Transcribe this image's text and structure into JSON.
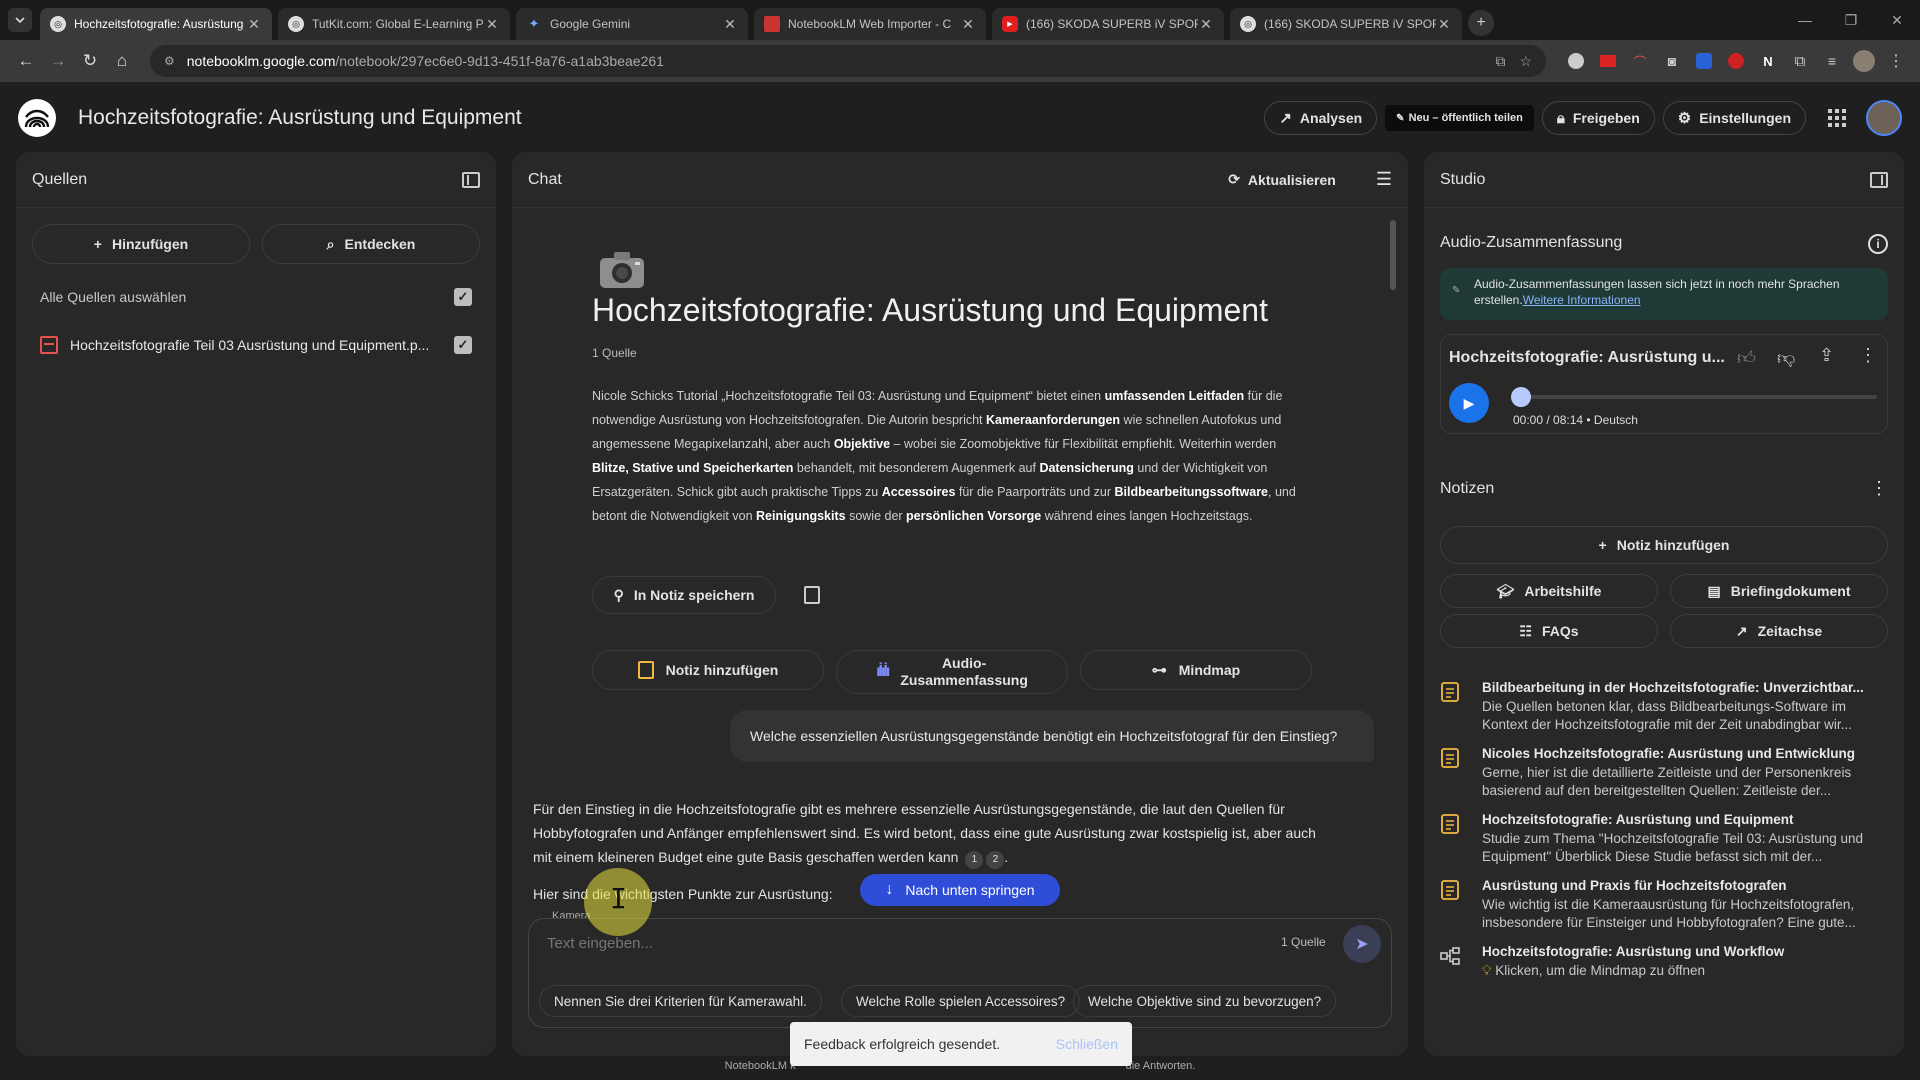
{
  "browser": {
    "tabs": [
      {
        "title": "Hochzeitsfotografie: Ausrüstung",
        "active": true
      },
      {
        "title": "TutKit.com: Global E-Learning P",
        "active": false
      },
      {
        "title": "Google Gemini",
        "active": false
      },
      {
        "title": "NotebookLM Web Importer - C",
        "active": false
      },
      {
        "title": "(166) SKODA SUPERB iV SPORT",
        "active": false
      },
      {
        "title": "(166) SKODA SUPERB iV SPORT",
        "active": false
      }
    ],
    "url_host": "notebooklm.google.com",
    "url_path": "/notebook/297ec6e0-9d13-451f-8a76-a1ab3beae261"
  },
  "header": {
    "title": "Hochzeitsfotografie: Ausrüstung und Equipment",
    "analytics": "Analysen",
    "new_badge": "Neu – öffentlich teilen",
    "share": "Freigeben",
    "settings": "Einstellungen"
  },
  "sources": {
    "title": "Quellen",
    "add": "Hinzufügen",
    "discover": "Entdecken",
    "select_all": "Alle Quellen auswählen",
    "items": [
      {
        "label": "Hochzeitsfotografie Teil 03 Ausrüstung und Equipment.p..."
      }
    ]
  },
  "chat": {
    "title": "Chat",
    "refresh": "Aktualisieren",
    "notebook_title": "Hochzeitsfotografie: Ausrüstung und Equipment",
    "source_count": "1 Quelle",
    "summary": [
      {
        "t": "Nicole Schicks Tutorial „Hochzeitsfotografie Teil 03: Ausrüstung und Equipment“ bietet einen ",
        "b": false
      },
      {
        "t": "umfassenden Leitfaden",
        "b": true
      },
      {
        "t": " für die notwendige Ausrüstung von Hochzeitsfotografen. Die Autorin bespricht ",
        "b": false
      },
      {
        "t": "Kameraanforderungen",
        "b": true
      },
      {
        "t": " wie schnellen Autofokus und angemessene Megapixelanzahl, aber auch ",
        "b": false
      },
      {
        "t": "Objektive",
        "b": true
      },
      {
        "t": " – wobei sie Zoomobjektive für Flexibilität empfiehlt. Weiterhin werden ",
        "b": false
      },
      {
        "t": "Blitze, Stative und Speicherkarten",
        "b": true
      },
      {
        "t": " behandelt, mit besonderem Augenmerk auf ",
        "b": false
      },
      {
        "t": "Datensicherung",
        "b": true
      },
      {
        "t": " und der Wichtigkeit von Ersatzgeräten. Schick gibt auch praktische Tipps zu ",
        "b": false
      },
      {
        "t": "Accessoires",
        "b": true
      },
      {
        "t": " für die Paarporträts und zur ",
        "b": false
      },
      {
        "t": "Bildbearbeitungssoftware",
        "b": true
      },
      {
        "t": ", und betont die Notwendigkeit von ",
        "b": false
      },
      {
        "t": "Reinigungskits",
        "b": true
      },
      {
        "t": " sowie der ",
        "b": false
      },
      {
        "t": "persönlichen Vorsorge",
        "b": true
      },
      {
        "t": " während eines langen Hochzeitstags.",
        "b": false
      }
    ],
    "save_note": "In Notiz speichern",
    "tiles": {
      "add_note": "Notiz hinzufügen",
      "audio_line1": "Audio-",
      "audio_line2": "Zusammenfassung",
      "mindmap": "Mindmap"
    },
    "user_question": "Welche essenziellen Ausrüstungsgegenstände benötigt ein Hochzeitsfotograf für den Einstieg?",
    "answer": "Für den Einstieg in die Hochzeitsfotografie gibt es mehrere essenzielle Ausrüstungsgegenstände, die laut den Quellen für Hobbyfotografen und Anfänger empfehlenswert sind. Es wird betont, dass eine gute Ausrüstung zwar kostspielig ist, aber auch mit einem kleineren Budget eine gute Basis geschaffen werden kann",
    "citations": [
      "1",
      "2"
    ],
    "answer_points": "Hier sind die wichtigsten Punkte zur Ausrüstung:",
    "answer_cut": "Kamera",
    "jump_down": "Nach unten springen",
    "input_placeholder": "Text eingeben...",
    "input_source_count": "1 Quelle",
    "suggestions": [
      "Nennen Sie drei Kriterien für Kamerawahl.",
      "Welche Rolle spielen Accessoires?",
      "Welche Objektive sind zu bevorzugen?"
    ]
  },
  "toast": {
    "message": "Feedback erfolgreich gesendet.",
    "close": "Schließen"
  },
  "footer": {
    "left": "NotebookLM k",
    "right": "die Antworten."
  },
  "studio": {
    "title": "Studio",
    "audio_heading": "Audio-Zusammenfassung",
    "banner_text": "Audio-Zusammenfassungen lassen sich jetzt in noch mehr Sprachen erstellen.",
    "banner_link": "Weitere Informationen",
    "player_title": "Hochzeitsfotografie: Ausrüstung u...",
    "player_time": "00:00 / 08:14 • Deutsch",
    "player_progress": 0.0,
    "notes_heading": "Notizen",
    "add_note": "Notiz hinzufügen",
    "buttons": {
      "study_guide": "Arbeitshilfe",
      "briefing": "Briefingdokument",
      "faq": "FAQs",
      "timeline": "Zeitachse"
    },
    "notes": [
      {
        "title": "Bildbearbeitung in der Hochzeitsfotografie: Unverzichtbar...",
        "body": "Die Quellen betonen klar, dass Bildbearbeitungs-Software im Kontext der Hochzeitsfotografie mit der Zeit unabdingbar wir...",
        "icon": "note-icon"
      },
      {
        "title": "Nicoles Hochzeitsfotografie: Ausrüstung und Entwicklung",
        "body": "Gerne, hier ist die detaillierte Zeitleiste und der Personenkreis basierend auf den bereitgestellten Quellen: Zeitleiste der...",
        "icon": "note-icon"
      },
      {
        "title": "Hochzeitsfotografie: Ausrüstung und Equipment",
        "body": "Studie zum Thema \"Hochzeitsfotografie Teil 03: Ausrüstung und Equipment\" Überblick Diese Studie befasst sich mit der...",
        "icon": "note-icon"
      },
      {
        "title": "Ausrüstung und Praxis für Hochzeitsfotografen",
        "body": "Wie wichtig ist die Kameraausrüstung für Hochzeitsfotografen, insbesondere für Einsteiger und Hobbyfotografen? Eine gute...",
        "icon": "note-icon"
      },
      {
        "title": "Hochzeitsfotografie: Ausrüstung und Workflow",
        "body": "Klicken, um die Mindmap zu öffnen",
        "icon": "mindmap-icon"
      }
    ]
  },
  "colors": {
    "accent": "#8ab4f8",
    "play": "#1a73e8",
    "jump": "#2f4dd6",
    "note_icon": "#f2b840",
    "cursor_highlight": "#e8e03a"
  }
}
